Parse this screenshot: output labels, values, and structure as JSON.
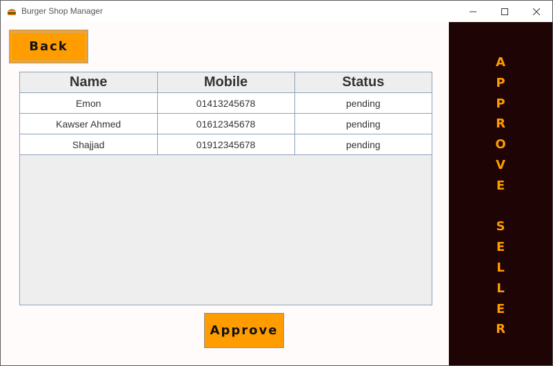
{
  "window": {
    "title": "Burger Shop Manager",
    "icon": "burger-icon",
    "controls": {
      "minimize": "—",
      "maximize": "☐",
      "close": "✕"
    }
  },
  "toolbar": {
    "back_label": "Back",
    "approve_label": "Approve"
  },
  "table": {
    "headers": [
      "Name",
      "Mobile",
      "Status"
    ],
    "rows": [
      [
        "Emon",
        "01413245678",
        "pending"
      ],
      [
        "Kawser Ahmed",
        "01612345678",
        "pending"
      ],
      [
        "Shajjad",
        "01912345678",
        "pending"
      ]
    ]
  },
  "side_panel": {
    "letters": [
      "A",
      "P",
      "P",
      "R",
      "O",
      "V",
      "E",
      "",
      "S",
      "E",
      "L",
      "L",
      "E",
      "R"
    ]
  },
  "colors": {
    "accent": "#ff9d00",
    "side_background": "#1e0404",
    "background": "#fffbfb"
  }
}
